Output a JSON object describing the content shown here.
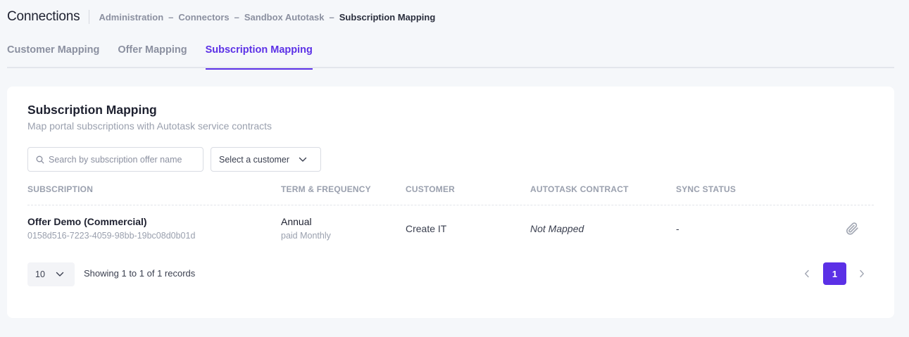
{
  "header": {
    "title": "Connections",
    "breadcrumb": [
      "Administration",
      "Connectors",
      "Sandbox Autotask",
      "Subscription Mapping"
    ],
    "separator": "–"
  },
  "tabs": [
    {
      "label": "Customer Mapping",
      "active": false
    },
    {
      "label": "Offer Mapping",
      "active": false
    },
    {
      "label": "Subscription Mapping",
      "active": true
    }
  ],
  "card": {
    "title": "Subscription Mapping",
    "subtitle": "Map portal subscriptions with Autotask service contracts"
  },
  "filters": {
    "search_placeholder": "Search by subscription offer name",
    "search_value": "",
    "customer_select_label": "Select a customer"
  },
  "table": {
    "columns": [
      "SUBSCRIPTION",
      "TERM & FREQUENCY",
      "CUSTOMER",
      "AUTOTASK CONTRACT",
      "SYNC STATUS"
    ],
    "rows": [
      {
        "subscription_name": "Offer Demo (Commercial)",
        "subscription_id": "0158d516-7223-4059-98bb-19bc08d0b01d",
        "term": "Annual",
        "frequency": "paid Monthly",
        "customer": "Create IT",
        "autotask_contract": "Not Mapped",
        "sync_status": "-",
        "action_icon": "paperclip-icon"
      }
    ]
  },
  "pagination": {
    "page_size": "10",
    "records_info": "Showing 1 to 1 of 1 records",
    "current_page": "1"
  },
  "colors": {
    "accent": "#5b30e6",
    "background": "#f5f7fa",
    "card": "#ffffff",
    "muted_text": "#9aa0ae"
  }
}
